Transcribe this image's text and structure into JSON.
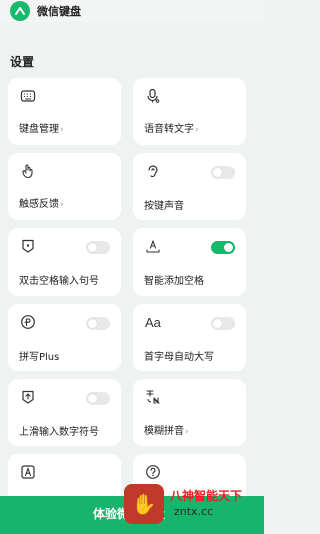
{
  "header": {
    "title": "微信键盘"
  },
  "section_title": "设置",
  "cards": {
    "keyboard_manage": {
      "label": "键盘管理",
      "chevron": "›",
      "icon": "keyboard-icon"
    },
    "voice_to_text": {
      "label": "语音转文字",
      "chevron": "›",
      "icon": "microphone-icon"
    },
    "haptic": {
      "label": "触感反馈",
      "chevron": "›",
      "icon": "tap-hand-icon"
    },
    "key_sound": {
      "label": "按键声音",
      "icon": "ear-icon",
      "toggle_on": false
    },
    "double_space": {
      "label": "双击空格输入句号",
      "icon": "keycap-dot-icon",
      "toggle_on": false
    },
    "smart_space": {
      "label": "智能添加空格",
      "icon": "space-icon",
      "toggle_on": true
    },
    "pinyin_plus": {
      "label": "拼写Plus",
      "icon": "spell-plus-icon",
      "toggle_on": false
    },
    "auto_capitalize": {
      "label": "首字母自动大写",
      "icon": "aa-icon",
      "toggle_on": false
    },
    "swipe_numbers": {
      "label": "上滑输入数字符号",
      "icon": "swipe-up-icon",
      "toggle_on": false
    },
    "fuzzy_pinyin": {
      "label": "模糊拼音",
      "chevron": "›",
      "icon": "fuzzy-pinyin-icon"
    },
    "row6_left": {
      "icon": "letter-a-icon"
    },
    "row6_right": {
      "icon": "help-icon"
    }
  },
  "bottom": {
    "label": "体验微信键盘"
  },
  "watermark": {
    "line1": "八神智能天下",
    "line2": "zntx.cc"
  },
  "colors": {
    "accent": "#16b86a",
    "background": "#eef3f1",
    "card": "#ffffff"
  }
}
